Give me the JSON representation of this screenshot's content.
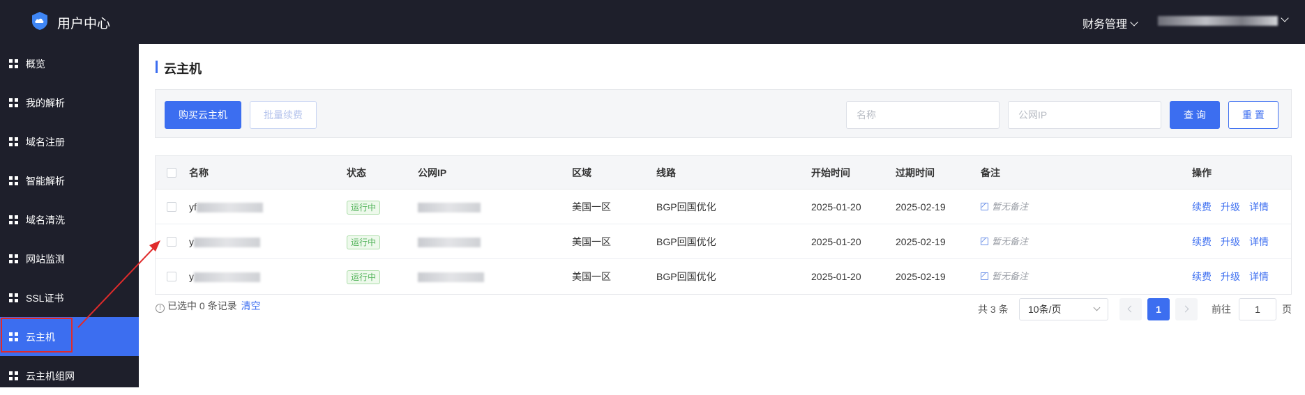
{
  "header": {
    "app_title": "用户中心",
    "finance_menu": "财务管理",
    "user_menu_icon": "chevron-down-icon"
  },
  "sidebar": {
    "items": [
      {
        "label": "概览",
        "icon": "grid-icon"
      },
      {
        "label": "我的解析",
        "icon": "grid-icon"
      },
      {
        "label": "域名注册",
        "icon": "grid-icon"
      },
      {
        "label": "智能解析",
        "icon": "grid-icon"
      },
      {
        "label": "域名清洗",
        "icon": "grid-icon"
      },
      {
        "label": "网站监测",
        "icon": "grid-icon"
      },
      {
        "label": "SSL证书",
        "icon": "grid-icon"
      },
      {
        "label": "云主机",
        "icon": "grid-icon",
        "active": true
      },
      {
        "label": "云主机组网",
        "icon": "grid-icon"
      }
    ]
  },
  "page": {
    "title": "云主机"
  },
  "toolbar": {
    "buy_button": "购买云主机",
    "batch_renew_button": "批量续费",
    "name_placeholder": "名称",
    "ip_placeholder": "公网IP",
    "query_button": "查 询",
    "reset_button": "重 置"
  },
  "table": {
    "headers": [
      "名称",
      "状态",
      "公网IP",
      "区域",
      "线路",
      "开始时间",
      "过期时间",
      "备注",
      "操作"
    ],
    "rows": [
      {
        "name": "yf",
        "status": "运行中",
        "ip": "",
        "region": "美国一区",
        "line": "BGP回国优化",
        "start": "2025-01-20",
        "expire": "2025-02-19",
        "remark": "暂无备注",
        "actions": [
          "续费",
          "升级",
          "详情"
        ]
      },
      {
        "name": "y",
        "status": "运行中",
        "ip": "",
        "region": "美国一区",
        "line": "BGP回国优化",
        "start": "2025-01-20",
        "expire": "2025-02-19",
        "remark": "暂无备注",
        "actions": [
          "续费",
          "升级",
          "详情"
        ]
      },
      {
        "name": "y",
        "status": "运行中",
        "ip": "",
        "region": "美国一区",
        "line": "BGP回国优化",
        "start": "2025-01-20",
        "expire": "2025-02-19",
        "remark": "暂无备注",
        "actions": [
          "续费",
          "升级",
          "详情"
        ]
      }
    ]
  },
  "footer": {
    "selected_text": "已选中 0 条记录",
    "clear_link": "清空",
    "total_text": "共 3 条",
    "page_size": "10条/页",
    "current_page": "1",
    "goto_label": "前往",
    "goto_value": "1",
    "page_unit": "页"
  },
  "colors": {
    "sidebar_bg": "#1e1f2b",
    "accent": "#3c6ef0",
    "status_green": "#52b35a",
    "annotation_red": "#e02b2b"
  }
}
